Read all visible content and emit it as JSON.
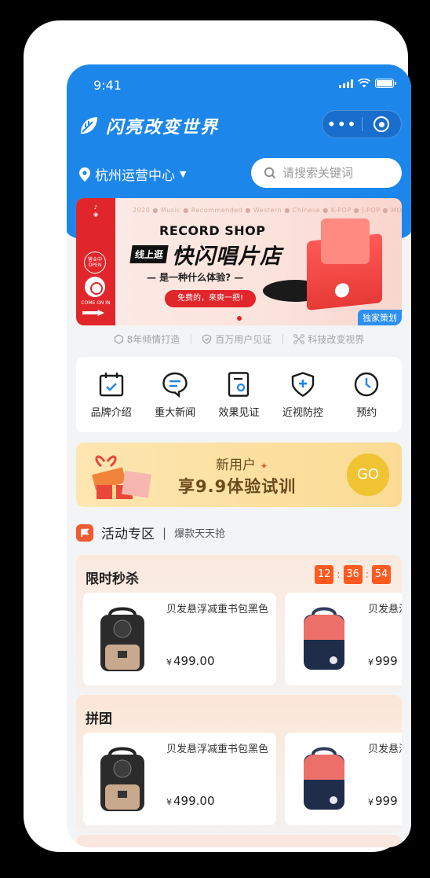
{
  "status_bar": {
    "time": "9:41"
  },
  "header": {
    "brand": "闪亮改变世界",
    "capsule_menu": "•••"
  },
  "location": {
    "label": "杭州运营中心"
  },
  "search": {
    "placeholder": "请搜索关键词"
  },
  "banner": {
    "tags": "2020 ● Music ● Recommended ● Western ● Chinese ● K-POP ● J-POP ● MORE",
    "title": "RECORD SHOP",
    "tag": "线上逛",
    "headline": "快闪唱片店",
    "subtitle": "— 是一种什么体验? —",
    "cta": "免费的，来爽一把!",
    "badge": "独家策划",
    "side_open": "营业中 OPEN",
    "side_bottom": "COME ON IN"
  },
  "trust": [
    {
      "icon": "hexagon-icon",
      "label": "8年倾情打造"
    },
    {
      "icon": "shield-icon",
      "label": "百万用户见证"
    },
    {
      "icon": "network-icon",
      "label": "科技改变视界"
    }
  ],
  "quick_nav": [
    {
      "icon": "calendar-icon",
      "label": "品牌介绍"
    },
    {
      "icon": "chat-icon",
      "label": "重大新闻"
    },
    {
      "icon": "document-icon",
      "label": "效果见证"
    },
    {
      "icon": "shield-plus-icon",
      "label": "近视防控"
    },
    {
      "icon": "clock-icon",
      "label": "预约"
    }
  ],
  "promo": {
    "line1": "新用户",
    "line2": "享9.9体验试训",
    "button": "GO"
  },
  "activity": {
    "title": "活动专区",
    "divider": "|",
    "subtitle": "爆款天天抢"
  },
  "flash_sale": {
    "title": "限时秒杀",
    "timer": [
      "12",
      "36",
      "54"
    ],
    "products": [
      {
        "name": "贝发悬浮减重书包黑色",
        "currency": "¥",
        "price": "499.00"
      },
      {
        "name": "贝发悬浮减重书包粉色",
        "currency": "¥",
        "price": "999"
      }
    ]
  },
  "group_buy": {
    "title": "拼团",
    "products": [
      {
        "name": "贝发悬浮减重书包黑色",
        "currency": "¥",
        "price": "499.00"
      },
      {
        "name": "贝发悬浮减重书包粉色",
        "currency": "¥",
        "price": "999"
      }
    ]
  },
  "colors": {
    "primary": "#1d86ea",
    "accent": "#ff5a1f",
    "promo_gold": "#f0c332"
  }
}
